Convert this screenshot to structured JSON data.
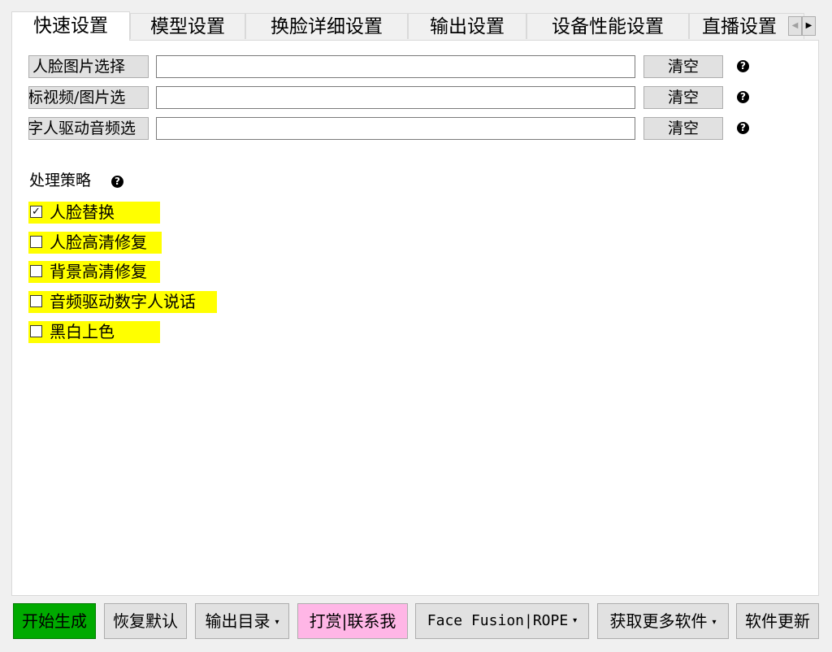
{
  "tabs": [
    {
      "label": "快速设置",
      "active": true
    },
    {
      "label": "模型设置",
      "active": false
    },
    {
      "label": "换脸详细设置",
      "active": false
    },
    {
      "label": "输出设置",
      "active": false
    },
    {
      "label": "设备性能设置",
      "active": false
    },
    {
      "label": "直播设置",
      "active": false
    }
  ],
  "tab_scroll": {
    "left_glyph": "◀",
    "right_glyph": "▶"
  },
  "file_rows": [
    {
      "select_label": "人脸图片选择",
      "path_value": "",
      "clear_label": "清空",
      "help_glyph": "?"
    },
    {
      "select_label": "标视频/图片选",
      "path_value": "",
      "clear_label": "清空",
      "help_glyph": "?"
    },
    {
      "select_label": "字人驱动音频选",
      "path_value": "",
      "clear_label": "清空",
      "help_glyph": "?"
    }
  ],
  "strategy": {
    "label": "处理策略",
    "help_glyph": "?",
    "check_glyph": "✓",
    "options": [
      {
        "label": "人脸替换",
        "checked": true
      },
      {
        "label": "人脸高清修复",
        "checked": false
      },
      {
        "label": "背景高清修复",
        "checked": false
      },
      {
        "label": "音频驱动数字人说话",
        "checked": false
      },
      {
        "label": "黑白上色",
        "checked": false
      }
    ]
  },
  "bottom_bar": {
    "start_label": "开始生成",
    "restore_label": "恢复默认",
    "output_dir_label": "输出目录",
    "donate_label": "打赏|联系我",
    "engine_label": "Face Fusion|ROPE",
    "more_software_label": "获取更多软件",
    "update_label": "软件更新",
    "caret_glyph": "▾"
  },
  "colors": {
    "highlight": "#ffff00",
    "start_button": "#00aa00",
    "donate_button": "#ffb6e6"
  }
}
